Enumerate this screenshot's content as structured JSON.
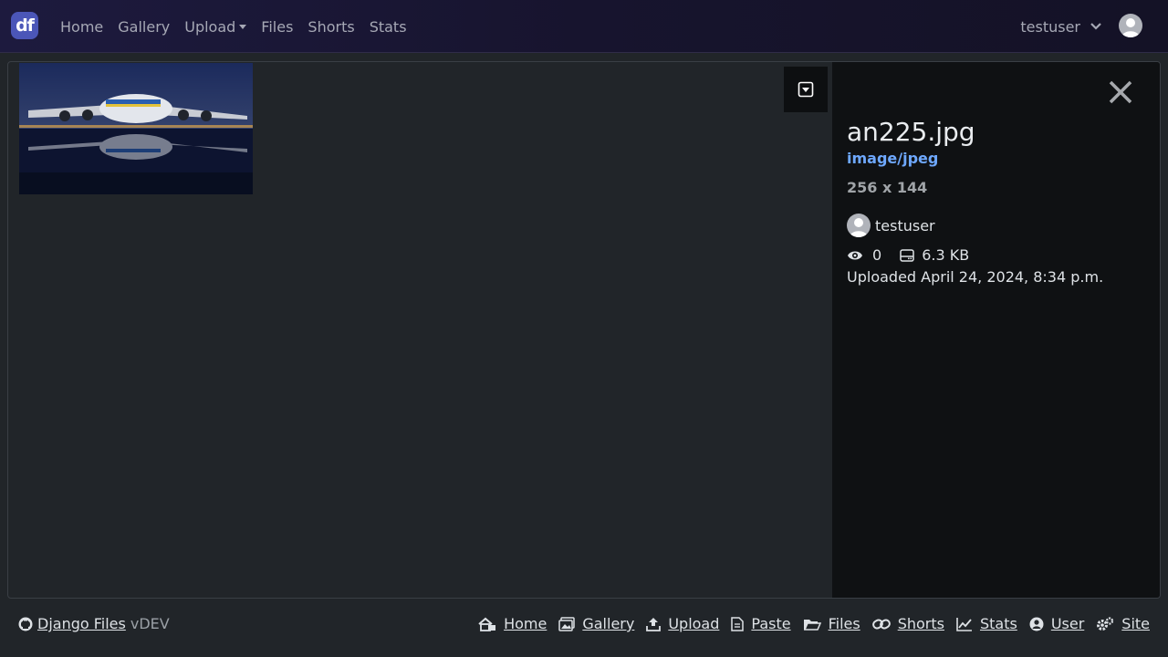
{
  "navbar": {
    "brand": "df",
    "links": [
      "Home",
      "Gallery",
      "Upload",
      "Files",
      "Shorts",
      "Stats"
    ],
    "username": "testuser"
  },
  "file": {
    "name": "an225.jpg",
    "mime": "image/jpeg",
    "dimensions": "256 x 144",
    "owner": "testuser",
    "views": "0",
    "size": "6.3 KB",
    "uploaded": "Uploaded April 24, 2024, 8:34 p.m."
  },
  "footer": {
    "brand": "Django Files",
    "version": "vDEV",
    "links": [
      "Home",
      "Gallery",
      "Upload",
      "Paste",
      "Files",
      "Shorts",
      "Stats",
      "User",
      "Site"
    ]
  },
  "colors": {
    "accent": "#6ea8fe",
    "brand": "#4b56b8",
    "sidebar_bg": "#0f1113"
  }
}
